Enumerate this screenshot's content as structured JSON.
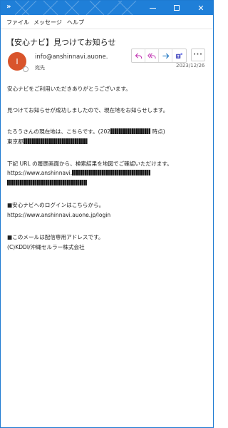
{
  "window": {
    "chevron": "»",
    "minimize_icon": "minimize-icon",
    "maximize_icon": "maximize-icon",
    "close_icon": "close-icon",
    "close_glyph": "✕"
  },
  "menu": [
    "ファイル",
    "メッセージ",
    "ヘルプ"
  ],
  "email": {
    "subject": "【安心ナビ】見つけてお知らせ",
    "avatar_initial": "I",
    "from": "info@anshinnavi.auone.",
    "to_label": "宛先",
    "date": "2023/12/26",
    "more_glyph": "···",
    "action_icons": [
      "reply-icon",
      "reply-all-icon",
      "forward-icon",
      "teams-icon"
    ],
    "paragraphs": {
      "greeting": "安心ナビをご利用いただきありがとうございます。",
      "notice": "見つけてお知らせが成功しましたので、現在地をお知らせします。",
      "location_prefix": "たろうさんの現在地は、こちらです。(202",
      "location_suffix": "時点)",
      "address_prefix": "東京都",
      "history_line": "下記 URL の履歴画面から、検索結果を地図でご確認いただけます。",
      "history_url_prefix": "https://www.anshinnavi.",
      "history_url_tail": "",
      "login_heading": "■安心ナビへのログインはこちらから。",
      "login_url": "https://www.anshinnavi.auone.jp/login",
      "footer_note": "■このメールは配信専用アドレスです。",
      "copyright": "(C)KDDI/沖縄セルラー株式会社"
    }
  },
  "colors": {
    "titlebar": "#1f7fd8",
    "avatar": "#d9542b",
    "reply_icons": "#c239b3",
    "forward_icon": "#0f6cbd",
    "teams_icon": "#5b5fc7"
  }
}
